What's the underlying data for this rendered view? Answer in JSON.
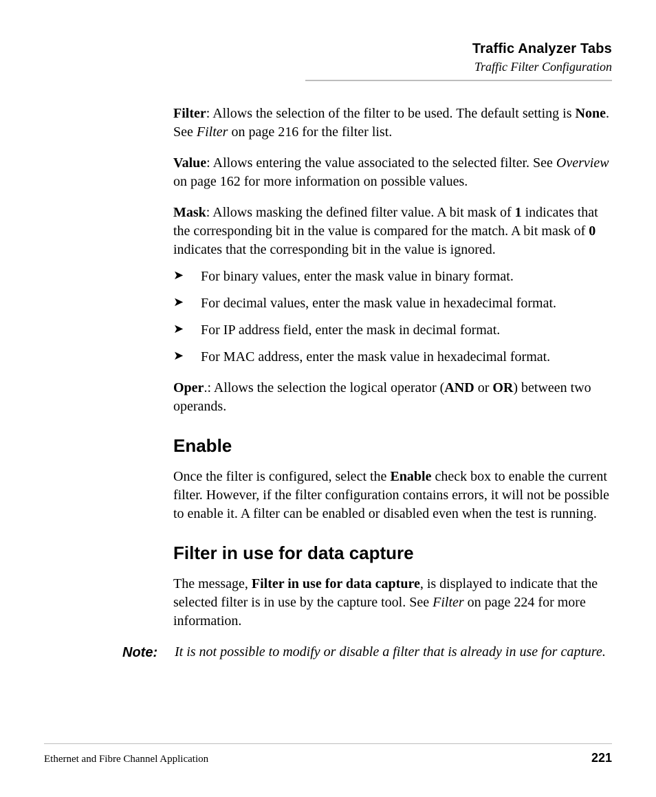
{
  "header": {
    "title": "Traffic Analyzer Tabs",
    "subtitle": "Traffic Filter Configuration"
  },
  "body": {
    "filter_label": "Filter",
    "filter_text_a": ": Allows the selection of the filter to be used. The default setting is ",
    "filter_bold_none": "None",
    "filter_text_b": ". See ",
    "filter_ital": "Filter",
    "filter_text_c": " on page 216 for the filter list.",
    "value_label": "Value",
    "value_text_a": ": Allows entering the value associated to the selected filter. See ",
    "value_ital": "Overview",
    "value_text_b": " on page 162 for more information on possible values.",
    "mask_label": "Mask",
    "mask_text_a": ": Allows masking the defined filter value. A bit mask of ",
    "mask_bold_1": "1",
    "mask_text_b": " indicates that the corresponding bit in the value is compared for the match. A bit mask of ",
    "mask_bold_0": "0",
    "mask_text_c": " indicates that the corresponding bit in the value is ignored.",
    "bullets": [
      "For binary values, enter the mask value in binary format.",
      "For decimal values, enter the mask value in hexadecimal format.",
      "For IP address field, enter the mask in decimal format.",
      "For MAC address, enter the mask value in hexadecimal format."
    ],
    "oper_label": "Oper",
    "oper_text_a": ".: Allows the selection the logical operator (",
    "oper_bold_and": "AND",
    "oper_text_b": " or ",
    "oper_bold_or": "OR",
    "oper_text_c": ") between two operands.",
    "h_enable": "Enable",
    "enable_text_a": "Once the filter is configured, select the ",
    "enable_bold": "Enable",
    "enable_text_b": " check box to enable the current filter. However, if the filter configuration contains errors, it will not be possible to enable it. A filter can be enabled or disabled even when the test is running.",
    "h_filterinuse": "Filter in use for data capture",
    "fiu_text_a": "The message, ",
    "fiu_bold": "Filter in use for data capture",
    "fiu_text_b": ", is displayed to indicate that the selected filter is in use by the capture tool. See ",
    "fiu_ital": "Filter",
    "fiu_text_c": " on page 224 for more information.",
    "note_label": "Note:",
    "note_body": "It is not possible to modify or disable a filter that is already in use for capture."
  },
  "footer": {
    "left": "Ethernet and Fibre Channel Application",
    "page": "221"
  },
  "glyphs": {
    "arrow": "➤"
  }
}
